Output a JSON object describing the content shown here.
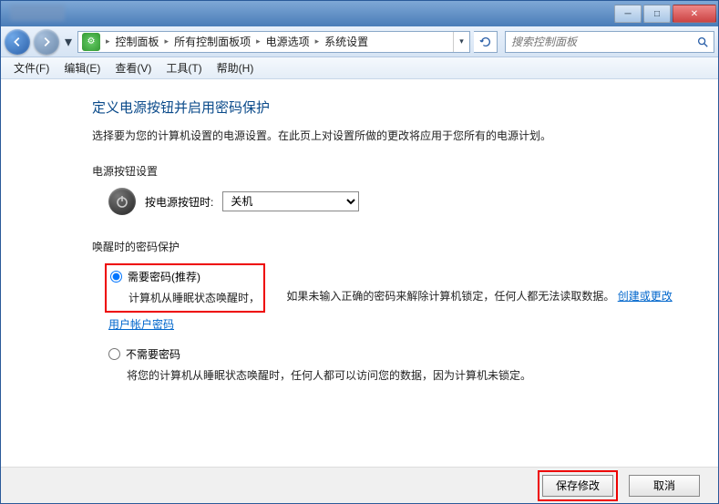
{
  "breadcrumb": {
    "items": [
      "控制面板",
      "所有控制面板项",
      "电源选项",
      "系统设置"
    ]
  },
  "search": {
    "placeholder": "搜索控制面板"
  },
  "menu": {
    "file": "文件(F)",
    "edit": "编辑(E)",
    "view": "查看(V)",
    "tools": "工具(T)",
    "help": "帮助(H)"
  },
  "page": {
    "title": "定义电源按钮并启用密码保护",
    "subtitle": "选择要为您的计算机设置的电源设置。在此页上对设置所做的更改将应用于您所有的电源计划。"
  },
  "power_button": {
    "section": "电源按钮设置",
    "label": "按电源按钮时:",
    "selected": "关机"
  },
  "password": {
    "section": "唤醒时的密码保护",
    "opt1": {
      "label": "需要密码(推荐)",
      "desc_a": "计算机从睡眠状态唤醒时，",
      "desc_b": "如果未输入正确的密码来解除计算机锁定，任何人都无法读取数据。",
      "link": "创建或更改用户帐户密码"
    },
    "opt2": {
      "label": "不需要密码",
      "desc": "将您的计算机从睡眠状态唤醒时，任何人都可以访问您的数据，因为计算机未锁定。"
    }
  },
  "buttons": {
    "save": "保存修改",
    "cancel": "取消"
  }
}
